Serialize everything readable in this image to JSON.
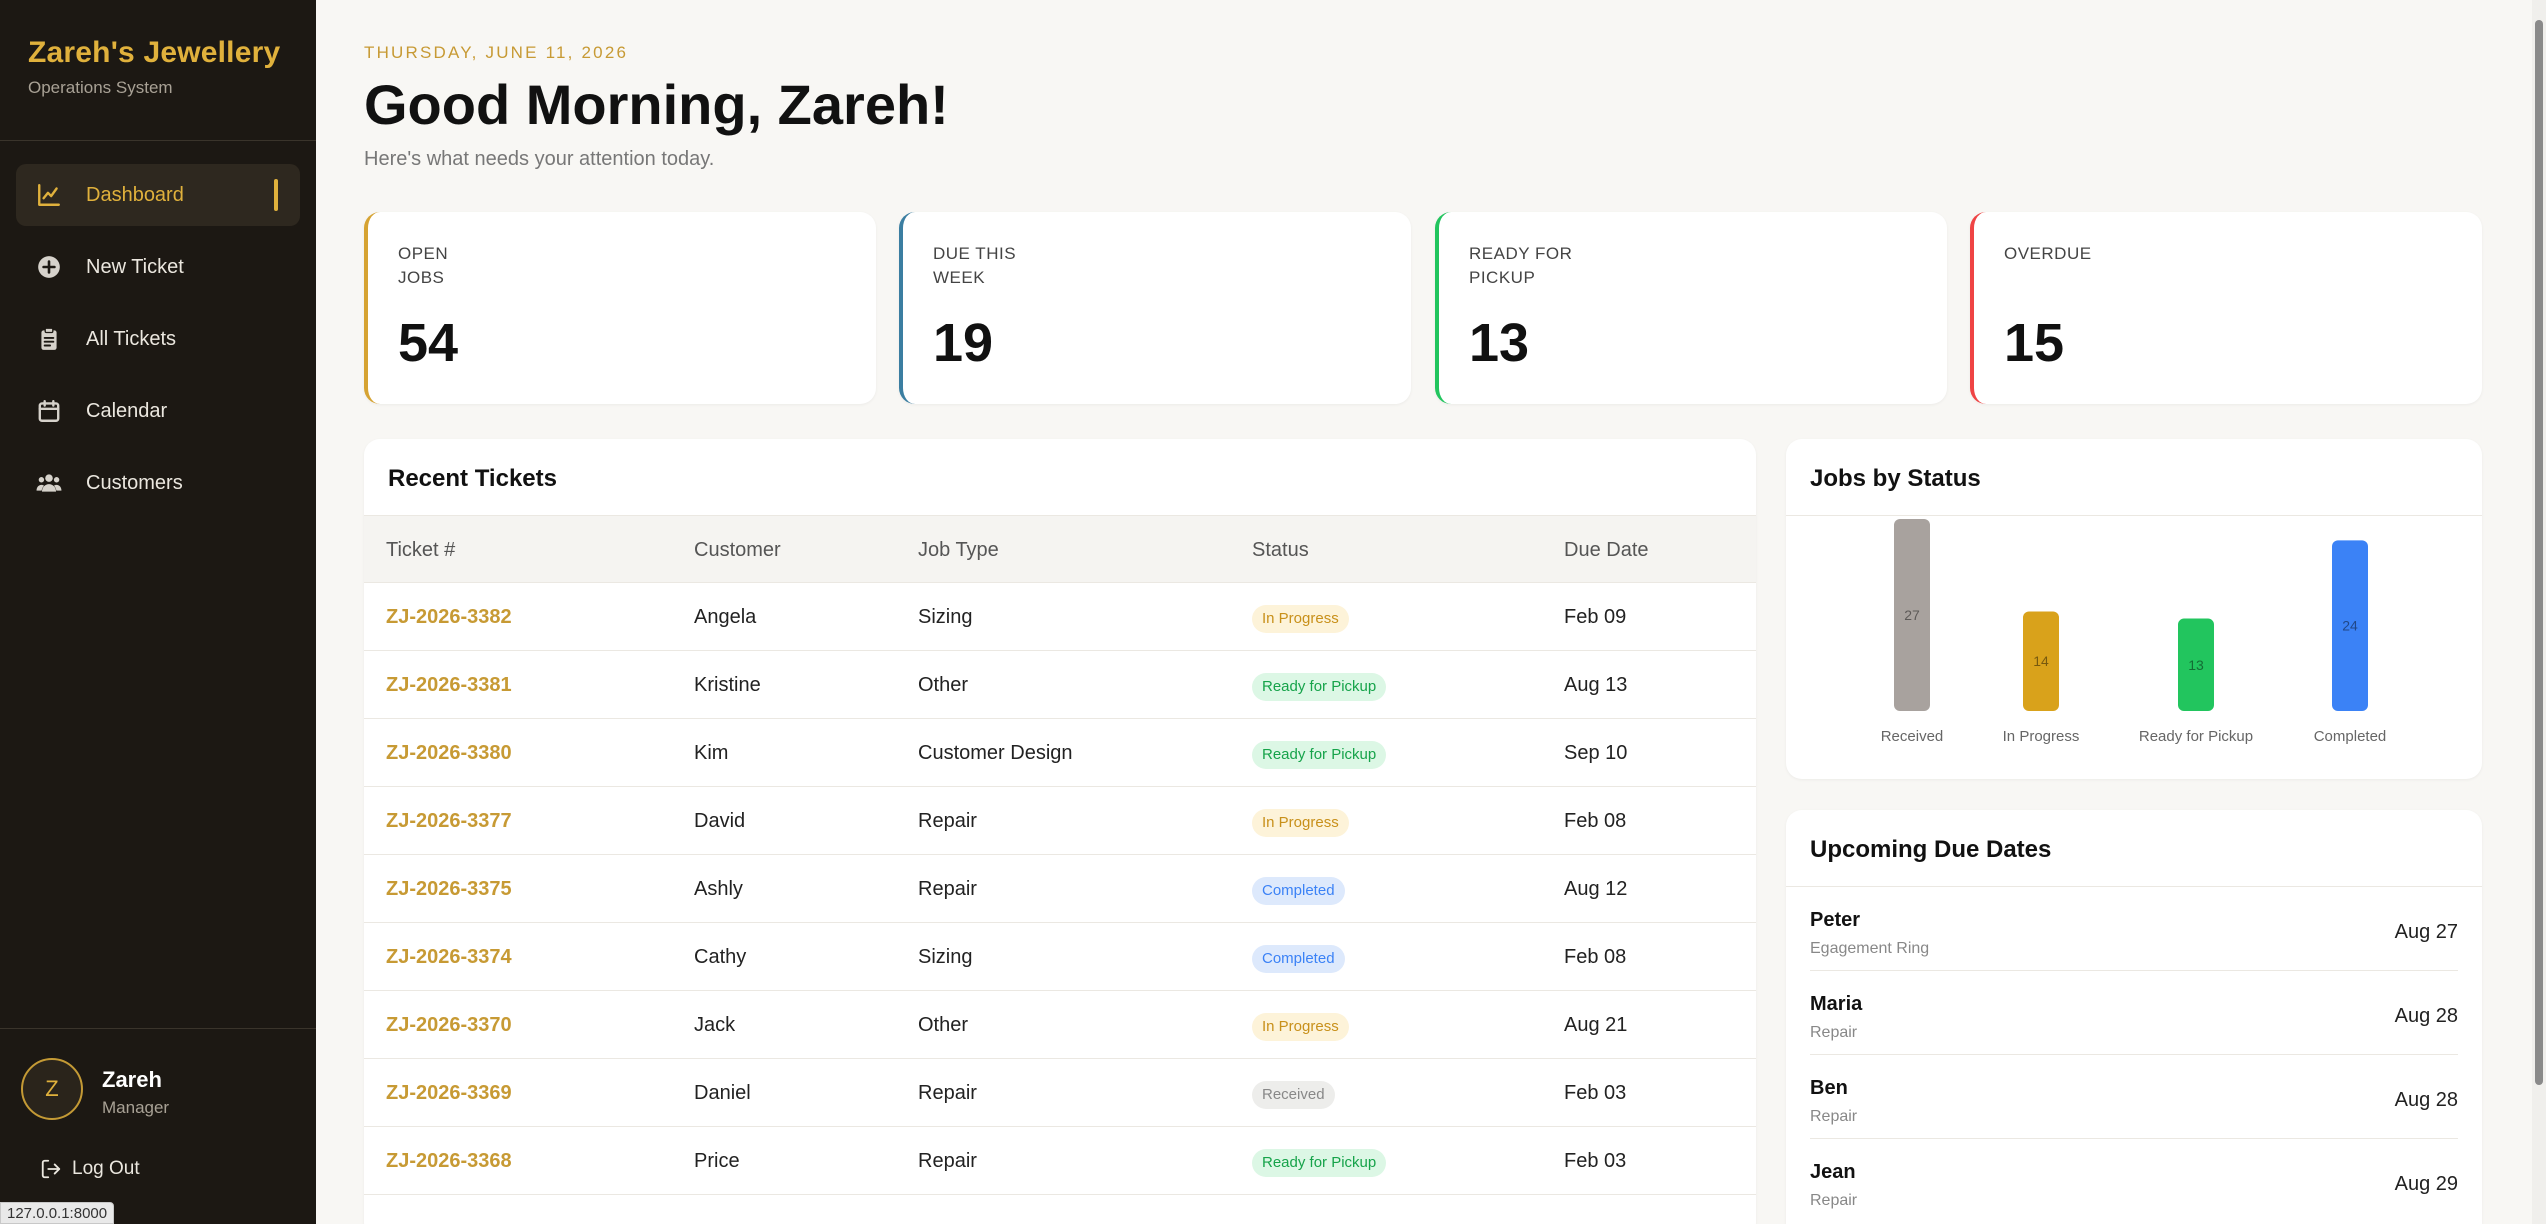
{
  "brand": {
    "name": "Zareh's Jewellery",
    "subtitle": "Operations System"
  },
  "nav": [
    {
      "label": "Dashboard",
      "icon": "chart-line-icon",
      "active": true
    },
    {
      "label": "New Ticket",
      "icon": "plus-circle-icon",
      "active": false
    },
    {
      "label": "All Tickets",
      "icon": "clipboard-icon",
      "active": false
    },
    {
      "label": "Calendar",
      "icon": "calendar-icon",
      "active": false
    },
    {
      "label": "Customers",
      "icon": "users-icon",
      "active": false
    }
  ],
  "user": {
    "initial": "Z",
    "name": "Zareh",
    "role": "Manager",
    "logout_label": "Log Out"
  },
  "status_url": "127.0.0.1:8000",
  "header": {
    "date": "THURSDAY, JUNE 11, 2026",
    "greeting": "Good Morning, Zareh!",
    "subtitle": "Here's what needs your attention today."
  },
  "stats": [
    {
      "label_line1": "OPEN",
      "label_line2": "JOBS",
      "value": "54",
      "color": "#d6a332"
    },
    {
      "label_line1": "DUE THIS",
      "label_line2": "WEEK",
      "value": "19",
      "color": "#3b7ea1"
    },
    {
      "label_line1": "READY FOR",
      "label_line2": "PICKUP",
      "value": "13",
      "color": "#22c55e"
    },
    {
      "label_line1": "OVERDUE",
      "label_line2": "",
      "value": "15",
      "color": "#ef4444"
    }
  ],
  "recent_tickets": {
    "title": "Recent Tickets",
    "columns": [
      "Ticket #",
      "Customer",
      "Job Type",
      "Status",
      "Due Date"
    ],
    "rows": [
      {
        "ticket": "ZJ-2026-3382",
        "customer": "Angela",
        "job": "Sizing",
        "status": "In Progress",
        "due": "Feb 09"
      },
      {
        "ticket": "ZJ-2026-3381",
        "customer": "Kristine",
        "job": "Other",
        "status": "Ready for Pickup",
        "due": "Aug 13"
      },
      {
        "ticket": "ZJ-2026-3380",
        "customer": "Kim",
        "job": "Customer Design",
        "status": "Ready for Pickup",
        "due": "Sep 10"
      },
      {
        "ticket": "ZJ-2026-3377",
        "customer": "David",
        "job": "Repair",
        "status": "In Progress",
        "due": "Feb 08"
      },
      {
        "ticket": "ZJ-2026-3375",
        "customer": "Ashly",
        "job": "Repair",
        "status": "Completed",
        "due": "Aug 12"
      },
      {
        "ticket": "ZJ-2026-3374",
        "customer": "Cathy",
        "job": "Sizing",
        "status": "Completed",
        "due": "Feb 08"
      },
      {
        "ticket": "ZJ-2026-3370",
        "customer": "Jack",
        "job": "Other",
        "status": "In Progress",
        "due": "Aug 21"
      },
      {
        "ticket": "ZJ-2026-3369",
        "customer": "Daniel",
        "job": "Repair",
        "status": "Received",
        "due": "Feb 03"
      },
      {
        "ticket": "ZJ-2026-3368",
        "customer": "Price",
        "job": "Repair",
        "status": "Ready for Pickup",
        "due": "Feb 03"
      }
    ]
  },
  "status_colors": {
    "In Progress": {
      "bg": "#fdf3d9",
      "fg": "#c8901a"
    },
    "Ready for Pickup": {
      "bg": "#dcf7e5",
      "fg": "#16a34a"
    },
    "Completed": {
      "bg": "#dde9fc",
      "fg": "#3b82f6"
    },
    "Received": {
      "bg": "#ededeb",
      "fg": "#888888"
    }
  },
  "chart_data": {
    "type": "bar",
    "title": "Jobs by Status",
    "categories": [
      "Received",
      "In Progress",
      "Ready for Pickup",
      "Completed"
    ],
    "values": [
      27,
      14,
      13,
      24
    ],
    "colors": [
      "#a8a29e",
      "#d9a21b",
      "#22c55e",
      "#3b82f6"
    ],
    "ylim": [
      0,
      27
    ],
    "grid": false
  },
  "upcoming": {
    "title": "Upcoming Due Dates",
    "items": [
      {
        "name": "Peter",
        "type": "Egagement Ring",
        "date": "Aug 27"
      },
      {
        "name": "Maria",
        "type": "Repair",
        "date": "Aug 28"
      },
      {
        "name": "Ben",
        "type": "Repair",
        "date": "Aug 28"
      },
      {
        "name": "Jean",
        "type": "Repair",
        "date": "Aug 29"
      }
    ]
  }
}
